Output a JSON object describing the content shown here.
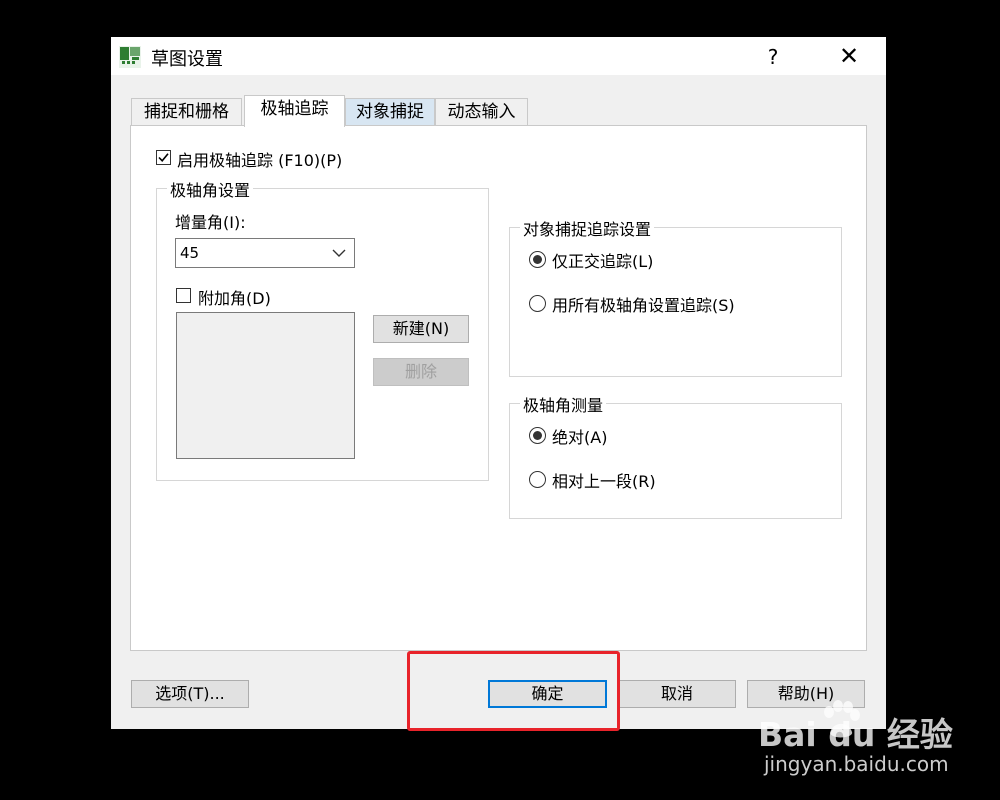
{
  "window": {
    "title": "草图设置",
    "help_glyph": "?",
    "close_glyph": "✕"
  },
  "tabs": [
    {
      "label": "捕捉和栅格"
    },
    {
      "label": "极轴追踪"
    },
    {
      "label": "对象捕捉"
    },
    {
      "label": "动态输入"
    }
  ],
  "polar": {
    "enable_label": "启用极轴追踪 (F10)(P)",
    "enable_checked": true,
    "angle_group_title": "极轴角设置",
    "increment_label": "增量角(I):",
    "increment_value": "45",
    "additional_label": "附加角(D)",
    "additional_checked": false,
    "new_button": "新建(N)",
    "delete_button": "删除"
  },
  "snap_tracking": {
    "group_title": "对象捕捉追踪设置",
    "option_ortho": "仅正交追踪(L)",
    "option_all": "用所有极轴角设置追踪(S)",
    "selected": "ortho"
  },
  "measurement": {
    "group_title": "极轴角测量",
    "option_absolute": "绝对(A)",
    "option_relative": "相对上一段(R)",
    "selected": "absolute"
  },
  "footer": {
    "options_button": "选项(T)...",
    "ok_button": "确定",
    "cancel_button": "取消",
    "help_button": "帮助(H)"
  },
  "watermark": {
    "brand": "Bai du 经验",
    "url": "jingyan.baidu.com"
  },
  "colors": {
    "highlight": "#e8232a",
    "default_button_border": "#0078d7"
  }
}
